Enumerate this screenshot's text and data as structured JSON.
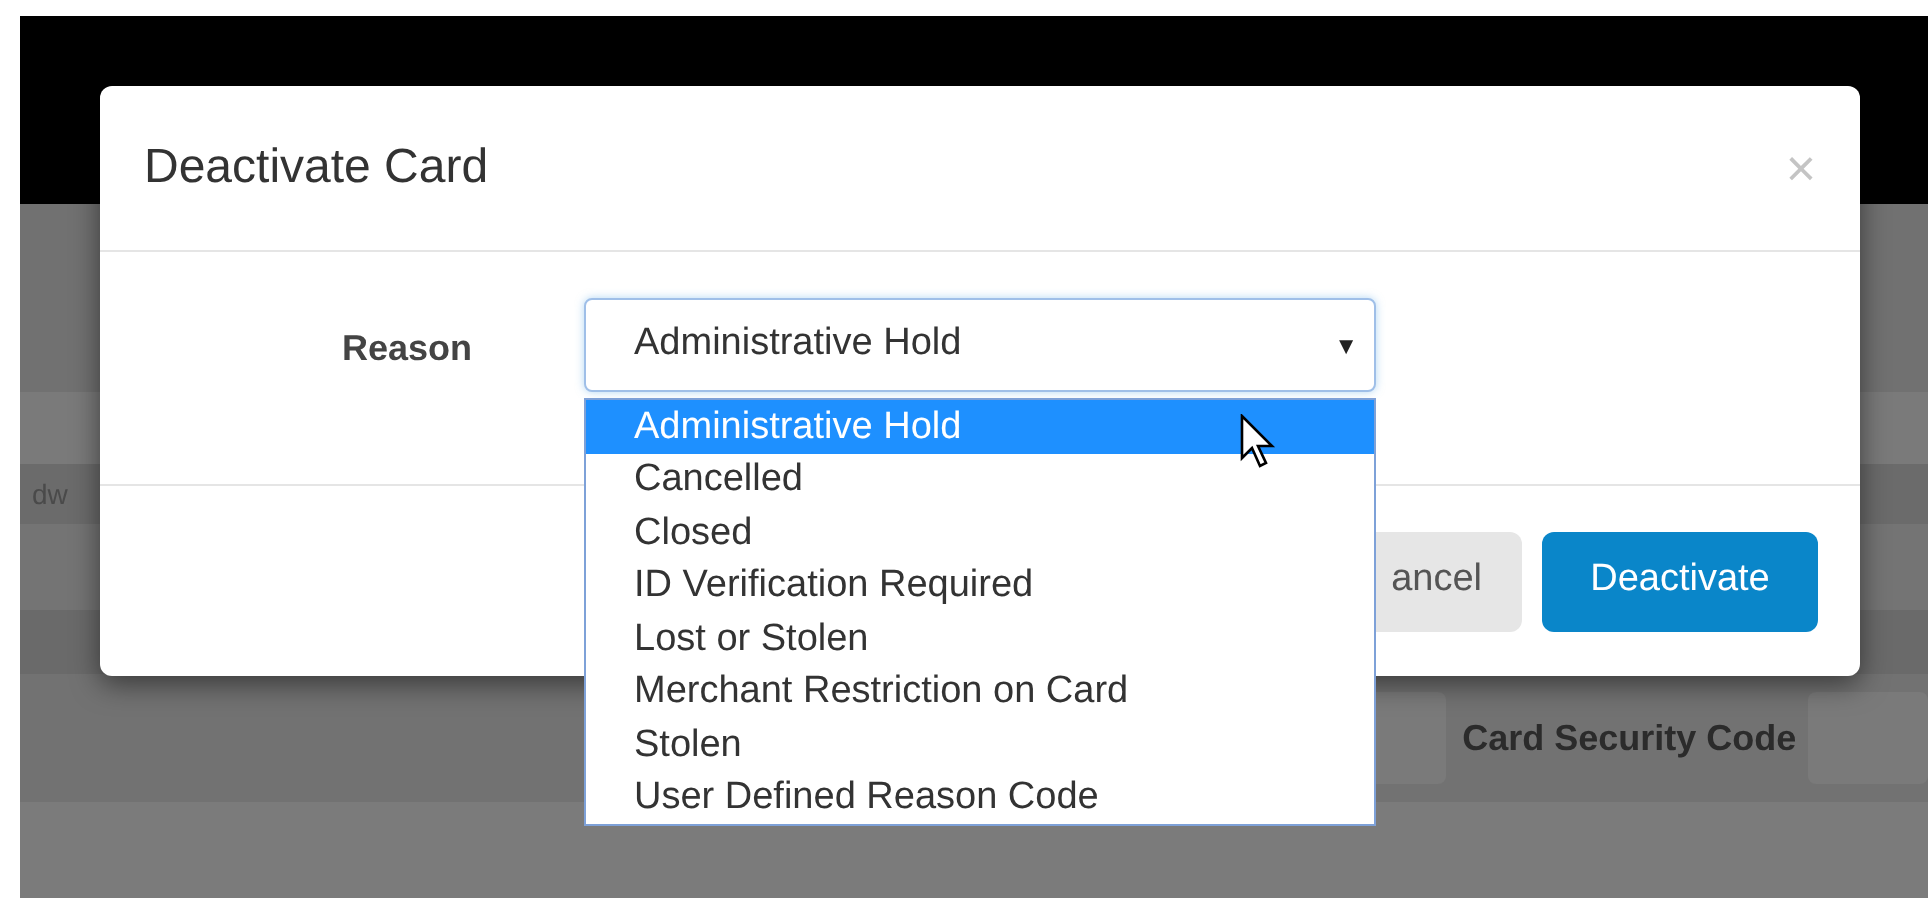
{
  "background": {
    "field_label": "dw",
    "security_code_label": "Card Security Code"
  },
  "dialog": {
    "title": "Deactivate Card",
    "close": "×",
    "reason_label": "Reason",
    "select": {
      "value": "Administrative Hold",
      "caret": "▼",
      "expanded": true
    },
    "options": [
      {
        "label": "Administrative Hold",
        "selected": true
      },
      {
        "label": "Cancelled",
        "selected": false
      },
      {
        "label": "Closed",
        "selected": false
      },
      {
        "label": "ID Verification Required",
        "selected": false
      },
      {
        "label": "Lost or Stolen",
        "selected": false
      },
      {
        "label": "Merchant Restriction on Card",
        "selected": false
      },
      {
        "label": "Stolen",
        "selected": false
      },
      {
        "label": "User Defined Reason Code",
        "selected": false
      }
    ],
    "buttons": [
      {
        "label": "ancel",
        "kind": "secondary"
      },
      {
        "label": "Deactivate",
        "kind": "primary"
      }
    ]
  }
}
